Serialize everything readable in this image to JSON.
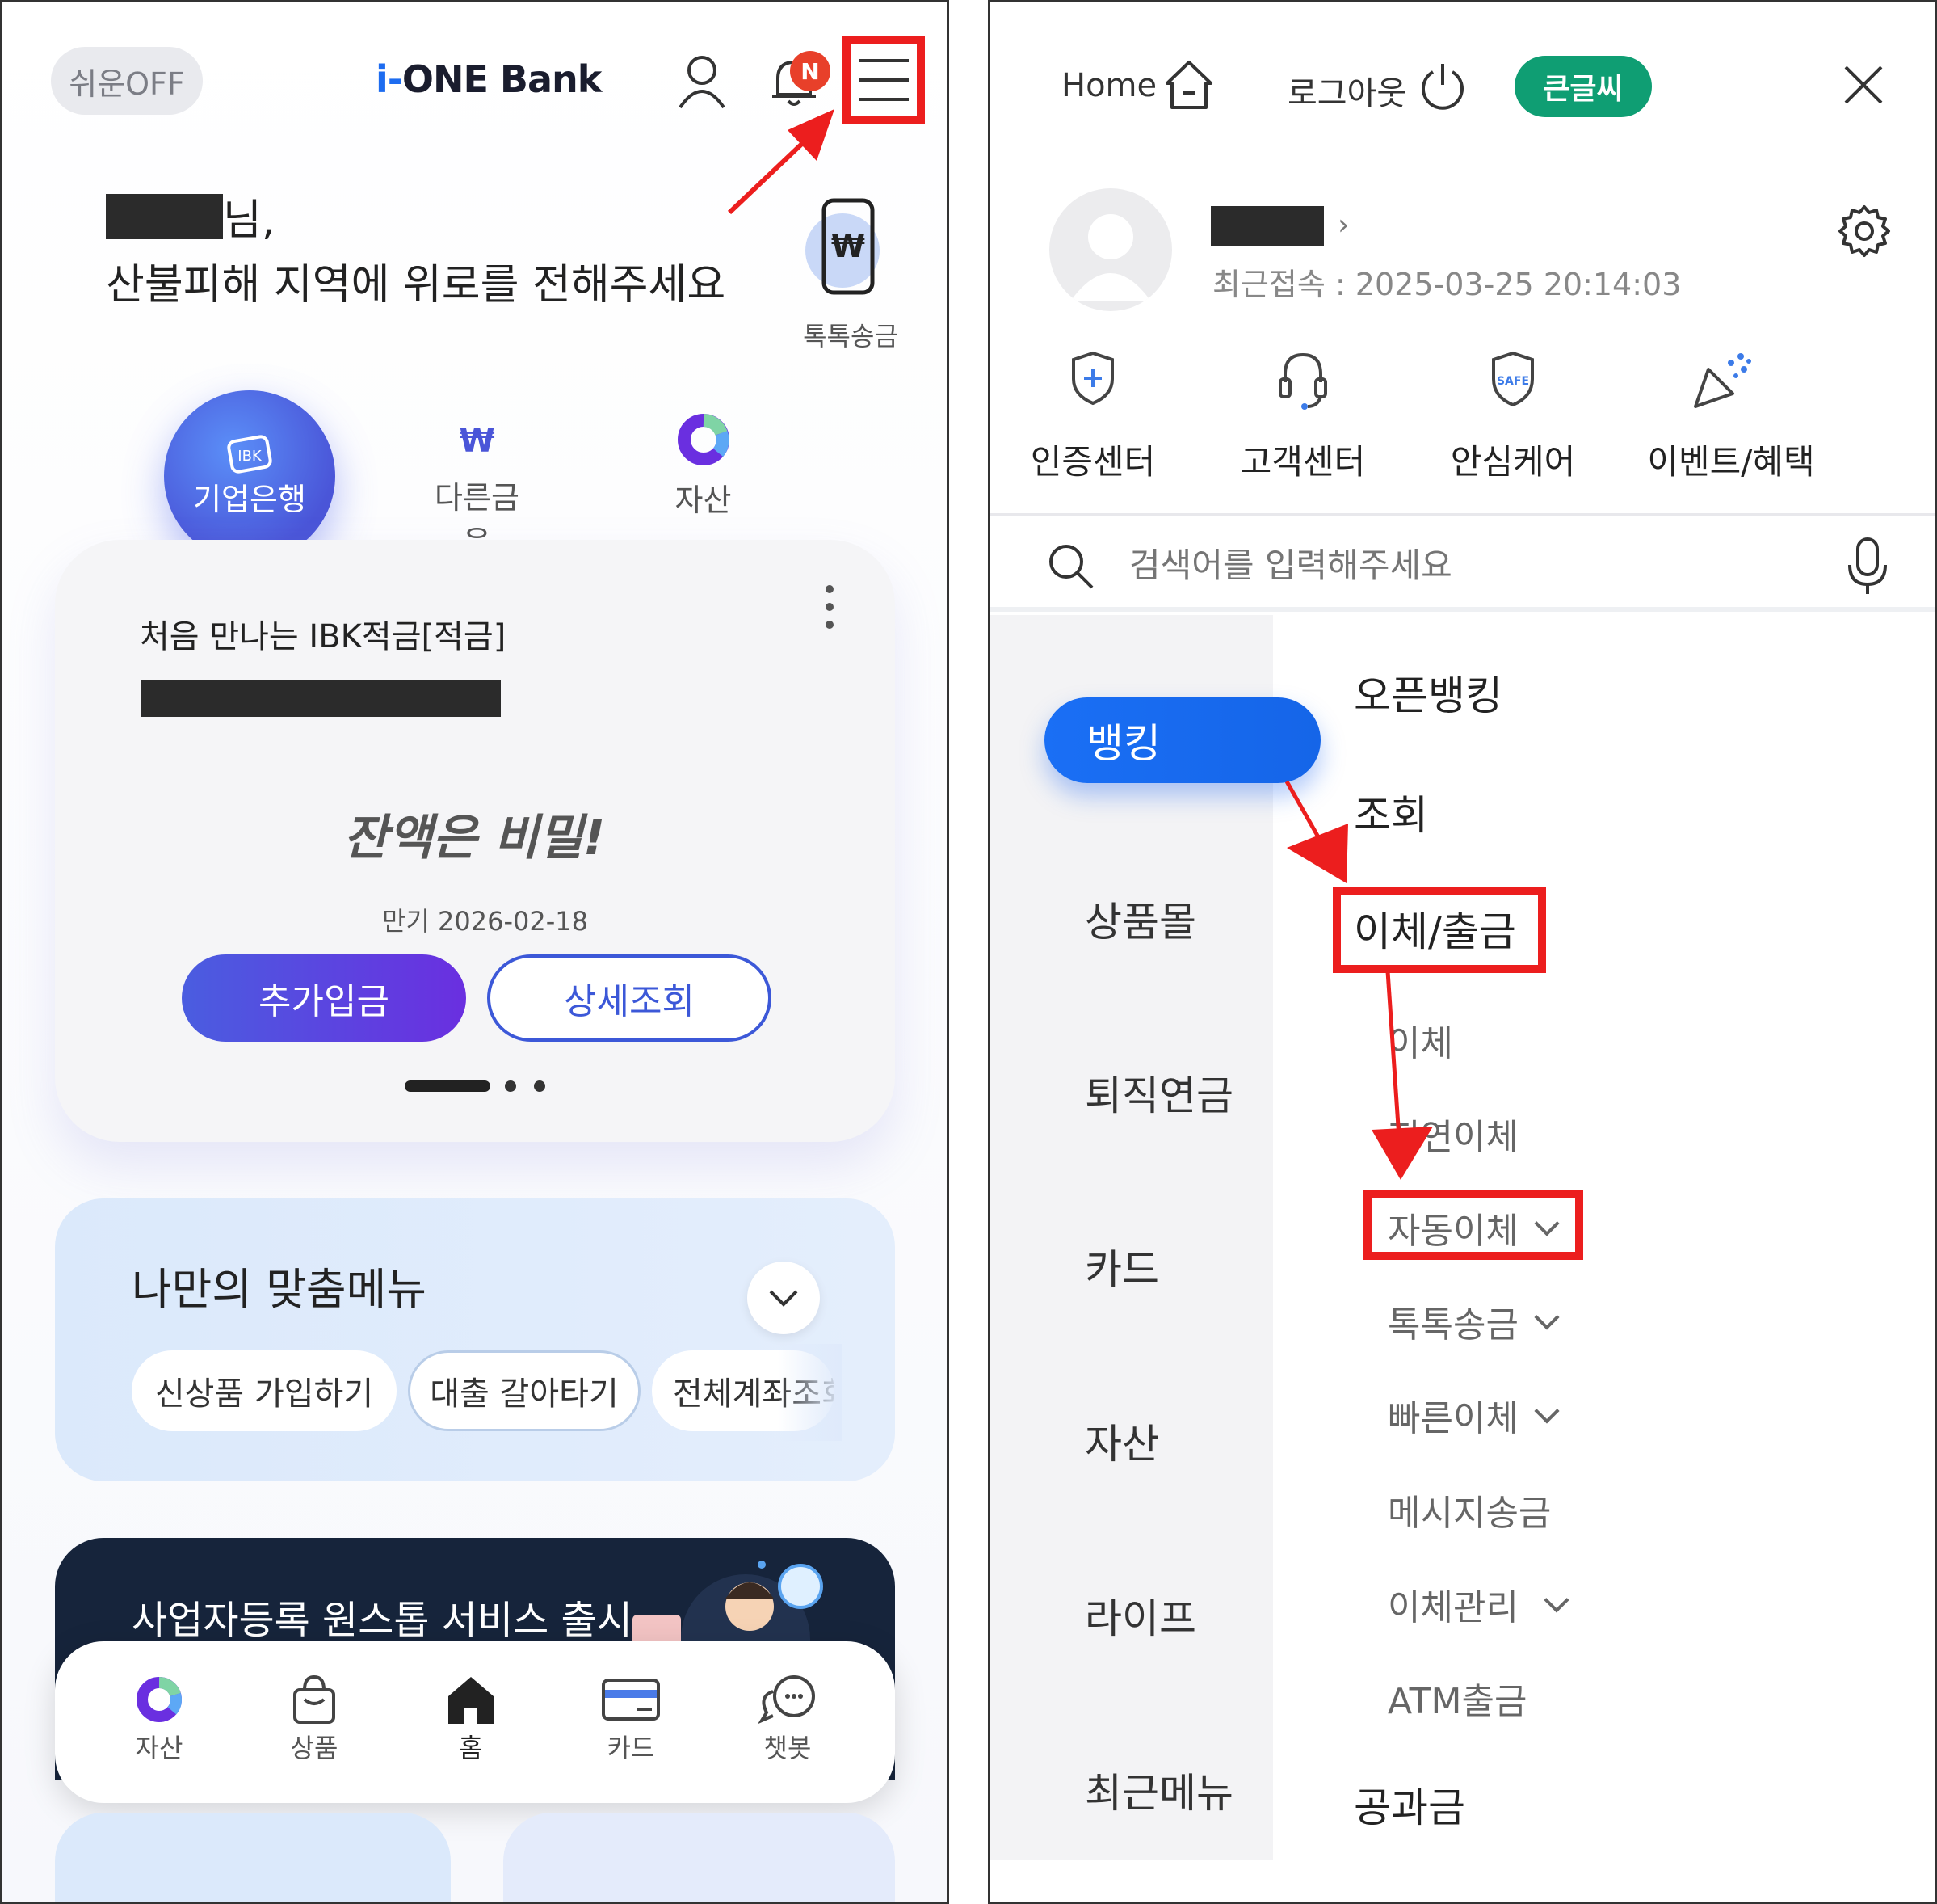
{
  "left": {
    "easy_mode": "쉬운OFF",
    "logo_prefix": "i-",
    "logo_main": "ONE Bank",
    "notification_badge": "N",
    "greeting_suffix": "님,",
    "greeting_message": "산불피해 지역에 위로를 전해주세요",
    "toktok_label": "톡톡송금",
    "tabs": [
      "기업은행",
      "다른금융",
      "자산"
    ],
    "account_card": {
      "product_name": "처음 만나는 IBK적금[적금]",
      "balance_hidden": "잔액은 비밀!",
      "maturity": "만기 2026-02-18",
      "deposit_button": "추가입금",
      "detail_button": "상세조회"
    },
    "custom_menu": {
      "title": "나만의 맞춤메뉴",
      "chips": [
        "신상품 가입하기",
        "대출 갈아타기",
        "전체계좌조회"
      ]
    },
    "banner_text": "사업자등록 원스톱 서비스 출시",
    "bottom_nav": [
      "자산",
      "상품",
      "홈",
      "카드",
      "챗봇"
    ]
  },
  "right": {
    "home_label": "Home",
    "logout_label": "로그아웃",
    "big_font_label": "큰글씨",
    "last_access": "최근접속 : 2025-03-25 20:14:03",
    "quick_menu": [
      "인증센터",
      "고객센터",
      "안심케어",
      "이벤트/혜택"
    ],
    "safe_icon_text": "SAFE",
    "search_placeholder": "검색어를 입력해주세요",
    "categories": [
      "뱅킹",
      "상품몰",
      "퇴직연금",
      "카드",
      "자산",
      "라이프",
      "최근메뉴"
    ],
    "submenu": {
      "open_banking": "오픈뱅킹",
      "inquiry": "조회",
      "transfer_withdraw": "이체/출금",
      "items": [
        "이체",
        "지연이체",
        "자동이체",
        "톡톡송금",
        "빠른이체",
        "메시지송금",
        "이체관리",
        "ATM출금"
      ],
      "utility": "공과금"
    }
  },
  "colors": {
    "highlight": "#ec1e1e",
    "primary_blue": "#1a6ff5",
    "green_badge": "#0f9e73"
  }
}
